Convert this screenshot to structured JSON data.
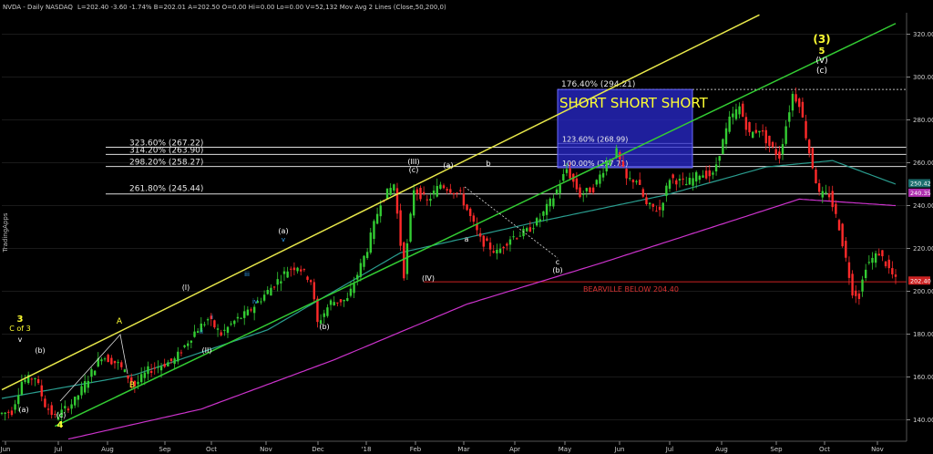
{
  "header": {
    "symbol": "NVDA - Daily  NASDAQ",
    "quote": "L=202.40  -3.60  -1.74%  B=202.01  A=202.50  O=0.00  Hi=0.00  Lo=0.00  V=52,132  Mov Avg 2 Lines (Close,50,200,0)",
    "ma50_value": "250.42",
    "ma200_value": "240.35"
  },
  "sidebar": {
    "watermark": "TradingApps"
  },
  "colors": {
    "background": "#000000",
    "up_candle": "#33cc33",
    "down_candle": "#ff2a2a",
    "ma50": "#2a9d8f",
    "ma200": "#cc33cc",
    "upper_channel": "#e8e84a",
    "lower_channel": "#33cc33",
    "fib_box": "#2a2ad0",
    "support_line": "#cc2222"
  },
  "chart_data": {
    "type": "candlestick",
    "period": "Daily",
    "ylim": [
      130,
      330
    ],
    "y_ticks": [
      140,
      160,
      180,
      200,
      220,
      240,
      260,
      280,
      300,
      320
    ],
    "x_ticks": [
      "Jun",
      "Jul",
      "Aug",
      "Sep",
      "Oct",
      "Nov",
      "Dec",
      "'18",
      "Feb",
      "Mar",
      "Apr",
      "May",
      "Jun",
      "Jul",
      "Aug",
      "Sep",
      "Oct",
      "Nov"
    ],
    "price_path_knots": [
      [
        0,
        143
      ],
      [
        3,
        144
      ],
      [
        6,
        158
      ],
      [
        10,
        160
      ],
      [
        13,
        147
      ],
      [
        16,
        141
      ],
      [
        22,
        149
      ],
      [
        30,
        170
      ],
      [
        35,
        166
      ],
      [
        40,
        156
      ],
      [
        44,
        163
      ],
      [
        52,
        168
      ],
      [
        58,
        181
      ],
      [
        62,
        187
      ],
      [
        66,
        180
      ],
      [
        70,
        186
      ],
      [
        74,
        190
      ],
      [
        80,
        200
      ],
      [
        86,
        210
      ],
      [
        89,
        212
      ],
      [
        93,
        205
      ],
      [
        95,
        185
      ],
      [
        99,
        195
      ],
      [
        104,
        196
      ],
      [
        110,
        220
      ],
      [
        114,
        242
      ],
      [
        118,
        250
      ],
      [
        121,
        208
      ],
      [
        124,
        248
      ],
      [
        128,
        242
      ],
      [
        132,
        250
      ],
      [
        138,
        245
      ],
      [
        144,
        224
      ],
      [
        149,
        218
      ],
      [
        153,
        225
      ],
      [
        158,
        228
      ],
      [
        162,
        234
      ],
      [
        166,
        244
      ],
      [
        170,
        257
      ],
      [
        174,
        245
      ],
      [
        178,
        248
      ],
      [
        182,
        260
      ],
      [
        185,
        265
      ],
      [
        188,
        252
      ],
      [
        191,
        252
      ],
      [
        194,
        240
      ],
      [
        198,
        238
      ],
      [
        201,
        253
      ],
      [
        206,
        250
      ],
      [
        210,
        255
      ],
      [
        214,
        254
      ],
      [
        216,
        265
      ],
      [
        219,
        280
      ],
      [
        222,
        286
      ],
      [
        225,
        273
      ],
      [
        228,
        276
      ],
      [
        231,
        268
      ],
      [
        234,
        263
      ],
      [
        238,
        292
      ],
      [
        240,
        288
      ],
      [
        243,
        265
      ],
      [
        246,
        245
      ],
      [
        249,
        245
      ],
      [
        252,
        230
      ],
      [
        256,
        200
      ],
      [
        258,
        198
      ],
      [
        260,
        212
      ],
      [
        264,
        218
      ],
      [
        269,
        205
      ]
    ],
    "moving_averages": [
      {
        "name": "MA 50",
        "value": 250.42,
        "knots": [
          [
            0,
            150
          ],
          [
            40,
            161
          ],
          [
            80,
            182
          ],
          [
            120,
            218
          ],
          [
            160,
            232
          ],
          [
            200,
            245
          ],
          [
            230,
            258
          ],
          [
            250,
            261
          ],
          [
            269,
            250
          ]
        ]
      },
      {
        "name": "MA 200",
        "value": 240.35,
        "knots": [
          [
            20,
            131
          ],
          [
            60,
            145
          ],
          [
            100,
            168
          ],
          [
            140,
            194
          ],
          [
            180,
            213
          ],
          [
            210,
            228
          ],
          [
            240,
            243
          ],
          [
            269,
            240
          ]
        ]
      }
    ],
    "horizontal_levels": [
      {
        "label": "176.40% (294.21)",
        "value": 294.21
      },
      {
        "label": "323.60% (267.22)",
        "value": 267.22
      },
      {
        "label": "314.20% (263.90)",
        "value": 263.9
      },
      {
        "label": "298.20% (258.27)",
        "value": 258.27
      },
      {
        "label": "261.80% (245.44)",
        "value": 245.44
      },
      {
        "label": "123.60% (268.99)",
        "value": 268.99
      },
      {
        "label": "100.00% (257.71)",
        "value": 257.71
      },
      {
        "label": "BEARVILLE BELOW 204.40",
        "value": 204.4
      }
    ],
    "channel_lines": [
      {
        "name": "upper-channel",
        "from": [
          0,
          154
        ],
        "to": [
          228,
          329
        ]
      },
      {
        "name": "lower-channel",
        "from": [
          16,
          137
        ],
        "to": [
          269,
          325
        ]
      }
    ],
    "annotations": {
      "fib_box_text": "SHORT SHORT SHORT",
      "wave_labels": [
        "3",
        "C of 3",
        "v",
        "(b)",
        "(a)",
        "(c)",
        "4",
        "A",
        "B",
        "(I)",
        "i",
        "ii",
        "(II)",
        "iii",
        "iv",
        "(a)",
        "v",
        "(b)",
        "(III)",
        "(c)",
        "(a)",
        "b",
        "a",
        "c",
        "(b)",
        "(IV)",
        "(3)",
        "5",
        "(V)",
        "(c)"
      ]
    }
  }
}
